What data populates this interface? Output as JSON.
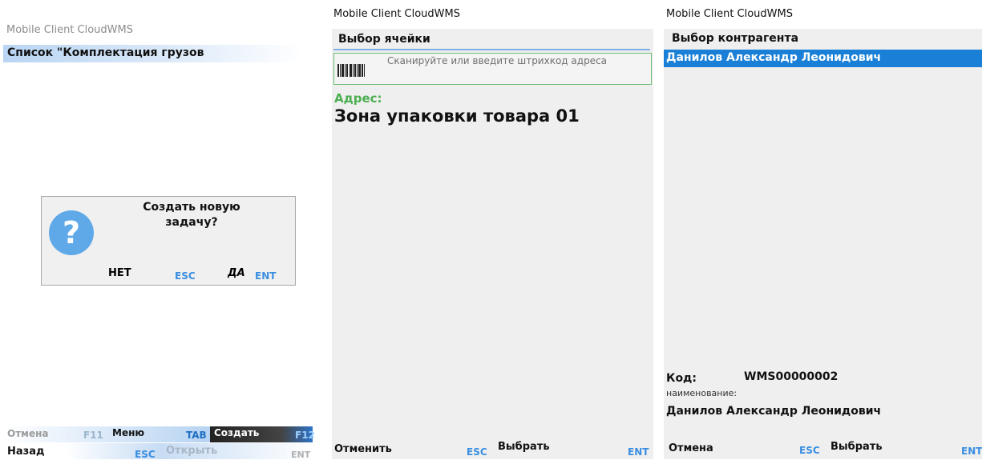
{
  "app_title": "Mobile Client CloudWMS",
  "screen1": {
    "header": "Список \"Комплектация грузов",
    "dialog": {
      "message": "Создать новую задачу?",
      "no_label": "НЕТ",
      "no_key": "ESC",
      "yes_label": "ДА",
      "yes_key": "ENT",
      "icon": "question-icon"
    },
    "bottom_row1": [
      {
        "label": "Отмена",
        "key": "F11"
      },
      {
        "label": "Меню",
        "key": "TAB"
      },
      {
        "label": "Создать",
        "key": "F12"
      }
    ],
    "bottom_row2": [
      {
        "label": "Назад",
        "key": "ESC"
      },
      {
        "label": "Открыть",
        "key": "ENT"
      }
    ]
  },
  "screen2": {
    "header": "Выбор ячейки",
    "scan_placeholder": "Сканируйте или введите штрихкод адреса",
    "address_label": "Адрес:",
    "address_value": "Зона упаковки товара 01",
    "cancel_label": "Отменить",
    "cancel_key": "ESC",
    "select_label": "Выбрать",
    "select_key": "ENT"
  },
  "screen3": {
    "header": "Выбор контрагента",
    "selected_item": "Данилов Александр Леонидович",
    "code_label": "Код:",
    "code_value": "WMS00000002",
    "name_label": "наименование:",
    "name_value": "Данилов Александр Леонидович",
    "cancel_label": "Отмена",
    "cancel_key": "ESC",
    "select_label": "Выбрать",
    "select_key": "ENT"
  },
  "colors": {
    "accent": "#3a8ee0",
    "selection": "#1a7fd6",
    "scan_border": "#6abb74",
    "address_label": "#4caf50"
  }
}
